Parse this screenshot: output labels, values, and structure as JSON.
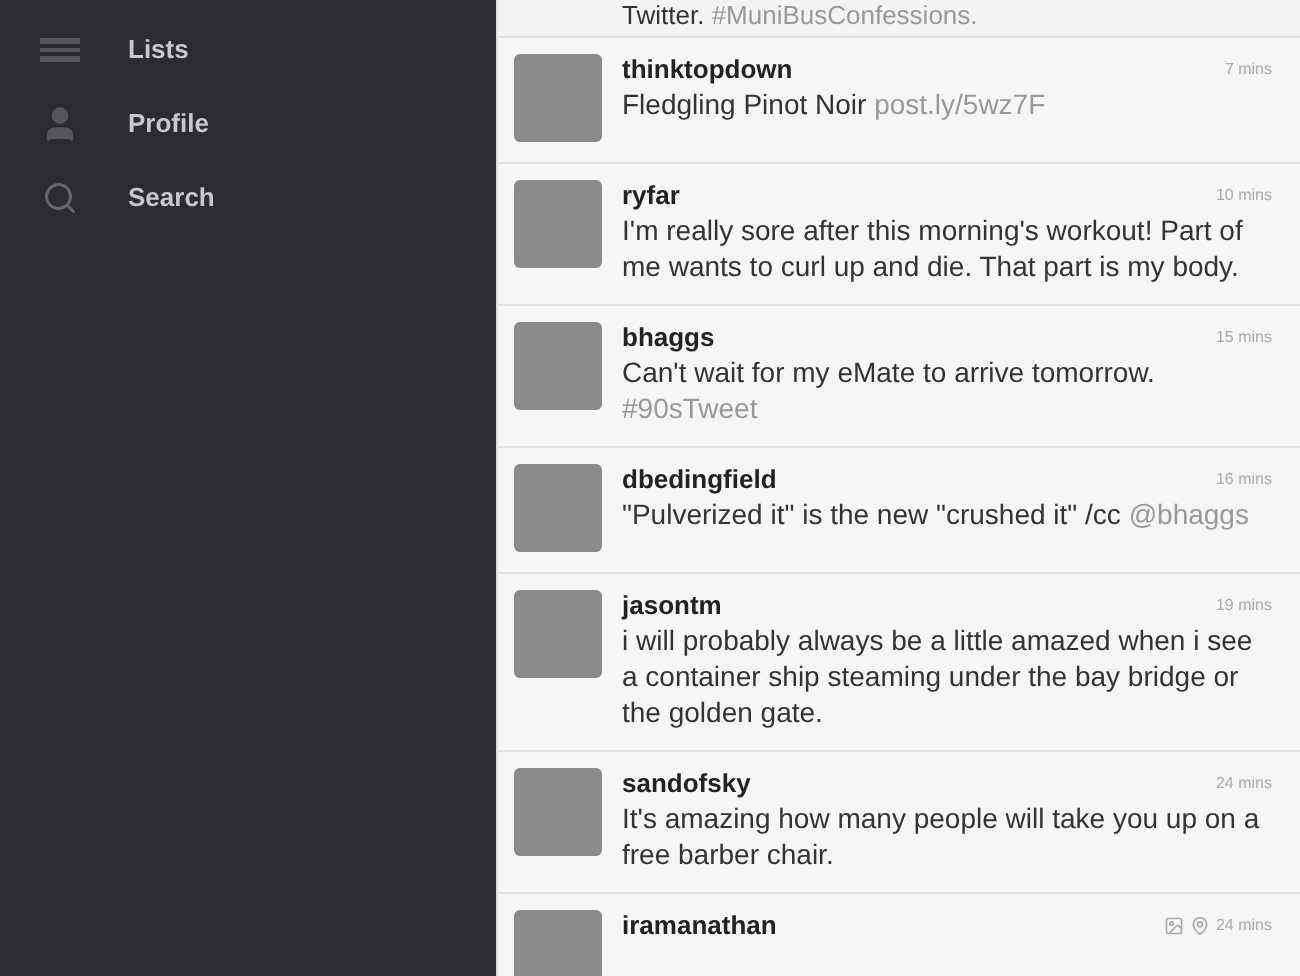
{
  "sidebar": {
    "items": [
      {
        "kind": "lists",
        "label": "Lists"
      },
      {
        "kind": "profile",
        "label": "Profile"
      },
      {
        "kind": "search",
        "label": "Search"
      }
    ]
  },
  "timeline": {
    "partial_tweet": {
      "text": "Twitter.",
      "link": "#MuniBusConfessions."
    },
    "tweets": [
      {
        "user": "thinktopdown",
        "time": "7 mins",
        "text": "Fledgling Pinot Noir",
        "link": "post.ly/5wz7F"
      },
      {
        "user": "ryfar",
        "time": "10 mins",
        "text": "I'm really sore after this morning's workout! Part of me wants to curl up and die. That part is my body."
      },
      {
        "user": "bhaggs",
        "time": "15 mins",
        "text": "Can't wait for my eMate to arrive tomorrow.",
        "link": "#90sTweet"
      },
      {
        "user": "dbedingfield",
        "time": "16 mins",
        "text": "\"Pulverized it\" is the new \"crushed it\" /cc",
        "link": "@bhaggs"
      },
      {
        "user": "jasontm",
        "time": "19 mins",
        "text": "i will probably always be a little amazed when i see a container ship steaming under the bay bridge or the golden gate."
      },
      {
        "user": "sandofsky",
        "time": "24 mins",
        "text": "It's amazing how many people will take you up on a free barber chair."
      },
      {
        "user": "iramanathan",
        "time": "24 mins",
        "has_media": true,
        "has_location": true
      }
    ]
  }
}
